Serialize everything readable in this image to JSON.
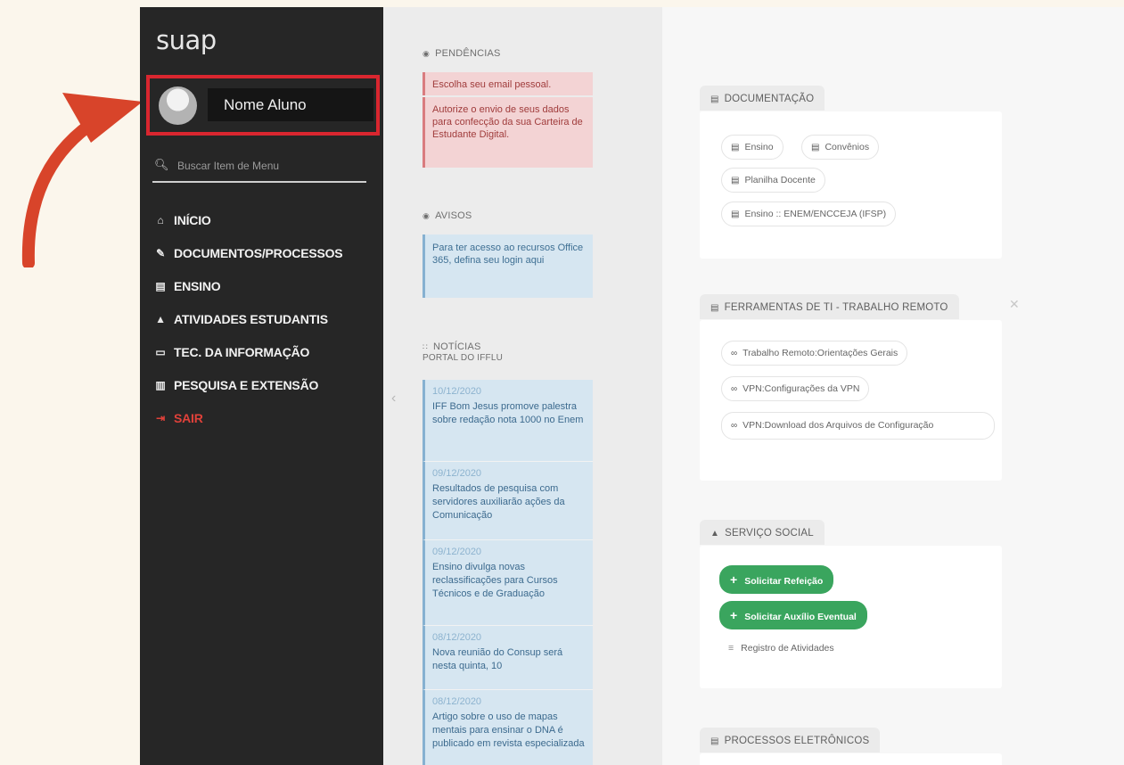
{
  "app": {
    "logo": "suap"
  },
  "user": {
    "name": "Nome Aluno"
  },
  "search": {
    "placeholder": "Buscar Item de Menu"
  },
  "nav": [
    {
      "label": "INÍCIO"
    },
    {
      "label": "DOCUMENTOS/PROCESSOS"
    },
    {
      "label": "ENSINO"
    },
    {
      "label": "ATIVIDADES ESTUDANTIS"
    },
    {
      "label": "TEC. DA INFORMAÇÃO"
    },
    {
      "label": "PESQUISA E EXTENSÃO"
    },
    {
      "label": "SAIR"
    }
  ],
  "pendencias": {
    "title": "PENDÊNCIAS",
    "items": [
      "Escolha seu email pessoal.",
      "Autorize o envio de seus dados para confecção da sua Carteira de Estudante Digital."
    ]
  },
  "avisos": {
    "title": "AVISOS",
    "items": [
      "Para ter acesso ao recursos Office 365, defina seu login aqui"
    ]
  },
  "noticias": {
    "title": "NOTÍCIAS",
    "subtitle": "PORTAL DO IFFLU",
    "items": [
      {
        "date": "10/12/2020",
        "title": "IFF Bom Jesus promove palestra sobre redação nota 1000 no Enem"
      },
      {
        "date": "09/12/2020",
        "title": "Resultados de pesquisa com servidores auxiliarão ações da Comunicação"
      },
      {
        "date": "09/12/2020",
        "title": "Ensino divulga novas reclassificações para Cursos Técnicos e de Graduação"
      },
      {
        "date": "08/12/2020",
        "title": "Nova reunião do Consup será nesta quinta, 10"
      },
      {
        "date": "08/12/2020",
        "title": "Artigo sobre o uso de mapas mentais para ensinar o DNA é publicado em revista especializada"
      }
    ]
  },
  "documentacao": {
    "title": "DOCUMENTAÇÃO",
    "links": [
      "Ensino",
      "Convênios",
      "Planilha Docente",
      "Ensino :: ENEM/ENCCEJA (IFSP)"
    ]
  },
  "ferramentas": {
    "title": "FERRAMENTAS DE TI - TRABALHO REMOTO",
    "links": [
      "Trabalho Remoto:Orientações Gerais",
      "VPN:Configurações da VPN",
      "VPN:Download dos Arquivos de Configuração"
    ]
  },
  "servico_social": {
    "title": "SERVIÇO SOCIAL",
    "buttons": [
      "Solicitar Refeição",
      "Solicitar Auxílio Eventual"
    ],
    "link": "Registro de Atividades"
  },
  "processos": {
    "title": "PROCESSOS ELETRÔNICOS"
  }
}
